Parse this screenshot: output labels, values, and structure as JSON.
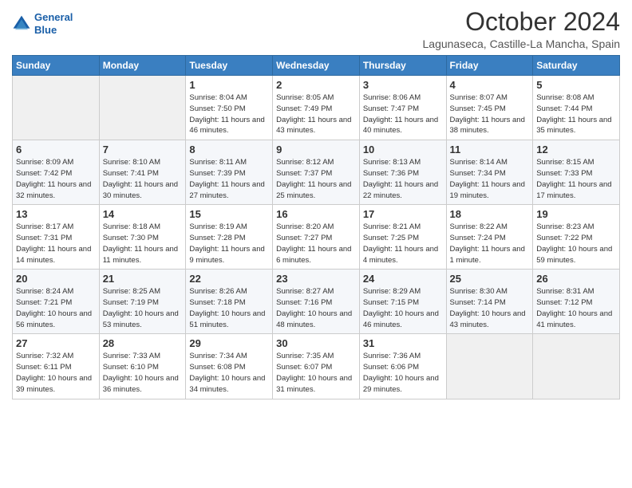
{
  "header": {
    "logo_line1": "General",
    "logo_line2": "Blue",
    "month": "October 2024",
    "location": "Lagunaseca, Castille-La Mancha, Spain"
  },
  "weekdays": [
    "Sunday",
    "Monday",
    "Tuesday",
    "Wednesday",
    "Thursday",
    "Friday",
    "Saturday"
  ],
  "weeks": [
    [
      {
        "day": "",
        "info": ""
      },
      {
        "day": "",
        "info": ""
      },
      {
        "day": "1",
        "info": "Sunrise: 8:04 AM\nSunset: 7:50 PM\nDaylight: 11 hours and 46 minutes."
      },
      {
        "day": "2",
        "info": "Sunrise: 8:05 AM\nSunset: 7:49 PM\nDaylight: 11 hours and 43 minutes."
      },
      {
        "day": "3",
        "info": "Sunrise: 8:06 AM\nSunset: 7:47 PM\nDaylight: 11 hours and 40 minutes."
      },
      {
        "day": "4",
        "info": "Sunrise: 8:07 AM\nSunset: 7:45 PM\nDaylight: 11 hours and 38 minutes."
      },
      {
        "day": "5",
        "info": "Sunrise: 8:08 AM\nSunset: 7:44 PM\nDaylight: 11 hours and 35 minutes."
      }
    ],
    [
      {
        "day": "6",
        "info": "Sunrise: 8:09 AM\nSunset: 7:42 PM\nDaylight: 11 hours and 32 minutes."
      },
      {
        "day": "7",
        "info": "Sunrise: 8:10 AM\nSunset: 7:41 PM\nDaylight: 11 hours and 30 minutes."
      },
      {
        "day": "8",
        "info": "Sunrise: 8:11 AM\nSunset: 7:39 PM\nDaylight: 11 hours and 27 minutes."
      },
      {
        "day": "9",
        "info": "Sunrise: 8:12 AM\nSunset: 7:37 PM\nDaylight: 11 hours and 25 minutes."
      },
      {
        "day": "10",
        "info": "Sunrise: 8:13 AM\nSunset: 7:36 PM\nDaylight: 11 hours and 22 minutes."
      },
      {
        "day": "11",
        "info": "Sunrise: 8:14 AM\nSunset: 7:34 PM\nDaylight: 11 hours and 19 minutes."
      },
      {
        "day": "12",
        "info": "Sunrise: 8:15 AM\nSunset: 7:33 PM\nDaylight: 11 hours and 17 minutes."
      }
    ],
    [
      {
        "day": "13",
        "info": "Sunrise: 8:17 AM\nSunset: 7:31 PM\nDaylight: 11 hours and 14 minutes."
      },
      {
        "day": "14",
        "info": "Sunrise: 8:18 AM\nSunset: 7:30 PM\nDaylight: 11 hours and 11 minutes."
      },
      {
        "day": "15",
        "info": "Sunrise: 8:19 AM\nSunset: 7:28 PM\nDaylight: 11 hours and 9 minutes."
      },
      {
        "day": "16",
        "info": "Sunrise: 8:20 AM\nSunset: 7:27 PM\nDaylight: 11 hours and 6 minutes."
      },
      {
        "day": "17",
        "info": "Sunrise: 8:21 AM\nSunset: 7:25 PM\nDaylight: 11 hours and 4 minutes."
      },
      {
        "day": "18",
        "info": "Sunrise: 8:22 AM\nSunset: 7:24 PM\nDaylight: 11 hours and 1 minute."
      },
      {
        "day": "19",
        "info": "Sunrise: 8:23 AM\nSunset: 7:22 PM\nDaylight: 10 hours and 59 minutes."
      }
    ],
    [
      {
        "day": "20",
        "info": "Sunrise: 8:24 AM\nSunset: 7:21 PM\nDaylight: 10 hours and 56 minutes."
      },
      {
        "day": "21",
        "info": "Sunrise: 8:25 AM\nSunset: 7:19 PM\nDaylight: 10 hours and 53 minutes."
      },
      {
        "day": "22",
        "info": "Sunrise: 8:26 AM\nSunset: 7:18 PM\nDaylight: 10 hours and 51 minutes."
      },
      {
        "day": "23",
        "info": "Sunrise: 8:27 AM\nSunset: 7:16 PM\nDaylight: 10 hours and 48 minutes."
      },
      {
        "day": "24",
        "info": "Sunrise: 8:29 AM\nSunset: 7:15 PM\nDaylight: 10 hours and 46 minutes."
      },
      {
        "day": "25",
        "info": "Sunrise: 8:30 AM\nSunset: 7:14 PM\nDaylight: 10 hours and 43 minutes."
      },
      {
        "day": "26",
        "info": "Sunrise: 8:31 AM\nSunset: 7:12 PM\nDaylight: 10 hours and 41 minutes."
      }
    ],
    [
      {
        "day": "27",
        "info": "Sunrise: 7:32 AM\nSunset: 6:11 PM\nDaylight: 10 hours and 39 minutes."
      },
      {
        "day": "28",
        "info": "Sunrise: 7:33 AM\nSunset: 6:10 PM\nDaylight: 10 hours and 36 minutes."
      },
      {
        "day": "29",
        "info": "Sunrise: 7:34 AM\nSunset: 6:08 PM\nDaylight: 10 hours and 34 minutes."
      },
      {
        "day": "30",
        "info": "Sunrise: 7:35 AM\nSunset: 6:07 PM\nDaylight: 10 hours and 31 minutes."
      },
      {
        "day": "31",
        "info": "Sunrise: 7:36 AM\nSunset: 6:06 PM\nDaylight: 10 hours and 29 minutes."
      },
      {
        "day": "",
        "info": ""
      },
      {
        "day": "",
        "info": ""
      }
    ]
  ]
}
